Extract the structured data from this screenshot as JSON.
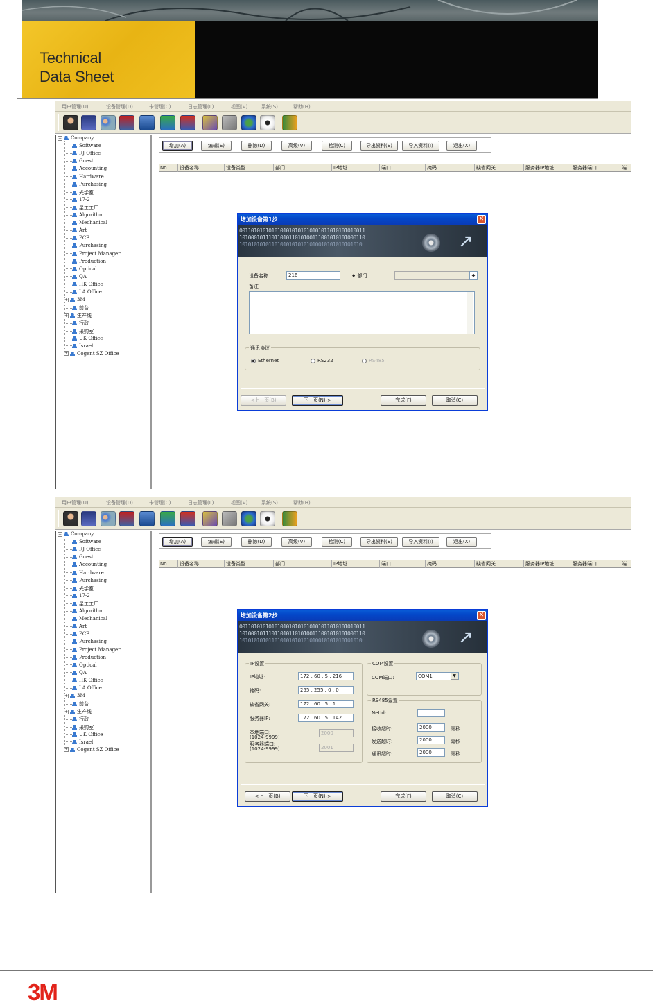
{
  "header": {
    "title_line1": "Technical",
    "title_line2": "Data Sheet"
  },
  "menu": [
    "用户管理(U)",
    "设备管理(D)",
    "卡管理(C)",
    "日志管理(L)",
    "视图(V)",
    "系统(S)",
    "帮助(H)"
  ],
  "tree": {
    "root": "Company",
    "items": [
      "Software",
      "RJ Office",
      "Guest",
      "Accounting",
      "Hardware",
      "Purchasing",
      "光学室",
      "17-2",
      "星工工厂",
      "Algorithm",
      "Mechanical",
      "Art",
      "PCB",
      "Purchasing",
      "Project Manager",
      "Production",
      "Optical",
      "QA",
      "HK Office",
      "LA Office",
      "3M",
      "前台",
      "生产线",
      "行政",
      "采购室",
      "UK Office",
      "Israel",
      "Cogent SZ Office"
    ],
    "expandable": [
      20,
      22,
      27
    ]
  },
  "action_buttons_1": [
    "增加(A)",
    "编辑(E)",
    "删除(D)",
    "高级(V)",
    "检测(C)",
    "导出资料(E)",
    "导入资料(I)",
    "退出(X)"
  ],
  "action_buttons_2": [
    "增加(A)",
    "编辑(E)",
    "删除(D)",
    "高级(V)",
    "检测(C)",
    "导出资料(E)",
    "导入资料(I)",
    "退出(X)"
  ],
  "columns": [
    "No",
    "设备名称",
    "设备类型",
    "部门",
    "IP地址",
    "端口",
    "掩码",
    "缺省网关",
    "服务器IP地址",
    "服务器端口",
    "端"
  ],
  "dialog1": {
    "title": "增加设备第1步",
    "binary1": "0011010101010101010101010101011010101010011",
    "binary2": "1010001011101101011010100111001010101000110",
    "binary3": "101010101011010101010101010010101010101010",
    "device_name_label": "设备名称",
    "device_name_value": "216",
    "dept_label": "部门",
    "notes_label": "备注",
    "protocol_group": "通讯协议",
    "opt_ethernet": "Ethernet",
    "opt_rs232": "RS232",
    "opt_rs485": "RS485",
    "btn_prev": "<上一页(B)",
    "btn_next": "下一页(N)->",
    "btn_finish": "完成(F)",
    "btn_cancel": "取消(C)"
  },
  "dialog2": {
    "title": "增加设备第2步",
    "binary1": "0011010101010101010101010101011010101010011",
    "binary2": "1010001011101101011010100111001010101000110",
    "binary3": "101010101011010101010101010010101010101010",
    "ip_group": "IP设置",
    "ip_label": "IP地址:",
    "ip_value": "172 . 60 . 5 . 216",
    "mask_label": "掩码:",
    "mask_value": "255 . 255 . 0 . 0",
    "gw_label": "缺省网关:",
    "gw_value": "172 . 60 . 5 . 1",
    "srv_label": "服务器IP:",
    "srv_value": "172 . 60 . 5 . 142",
    "local_port_label1": "本地端口:",
    "local_port_label2": "(1024-9999)",
    "local_port_value": "2000",
    "srv_port_label1": "服务器端口:",
    "srv_port_label2": "(1024-9999)",
    "srv_port_value": "2001",
    "com_group": "COM设置",
    "com_port_label": "COM端口:",
    "com_port_value": "COM1",
    "rs485_group": "RS485设置",
    "netid_label": "NetId:",
    "recv_label": "接收超时:",
    "recv_value": "2000",
    "send_label": "发送超时:",
    "send_value": "2000",
    "comm_label": "通讯超时:",
    "comm_value": "2000",
    "unit": "毫秒",
    "btn_prev": "<上一页(B)",
    "btn_next": "下一页(N)->",
    "btn_finish": "完成(F)",
    "btn_cancel": "取消(C)"
  },
  "footer": {
    "logo": "3M"
  }
}
